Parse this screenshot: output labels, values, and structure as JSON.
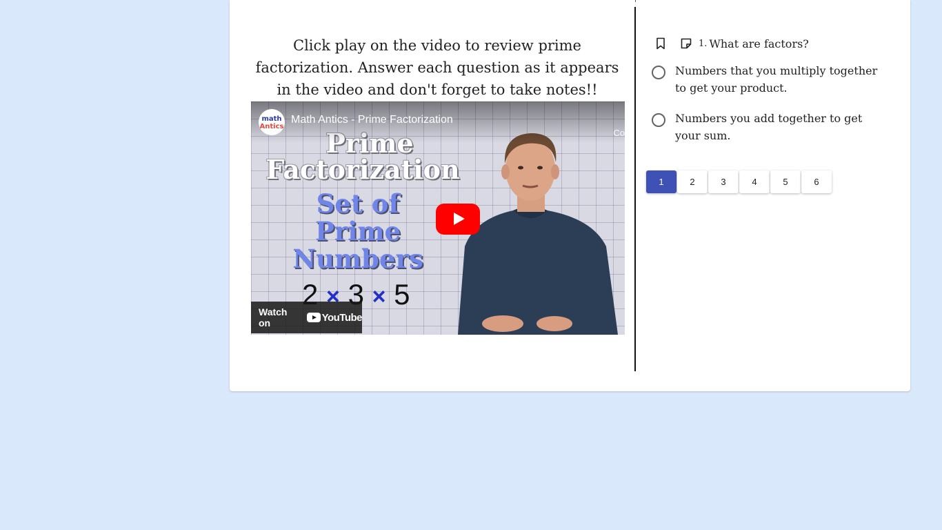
{
  "instructions": "Click play on the video to review prime factorization. Answer each question as it appears in the video and don't forget to take notes!!",
  "video": {
    "title": "Math Antics - Prime Factorization",
    "corner_text": "Co",
    "slide": {
      "title_line1": "Prime",
      "title_line2": "Factorization",
      "sub_line1": "Set of",
      "sub_line2": "Prime",
      "sub_line3": "Numbers",
      "eq_a": "2",
      "eq_x1": "×",
      "eq_b": "3",
      "eq_x2": "×",
      "eq_c": "5"
    },
    "watch_on_label": "Watch on",
    "youtube_label": "YouTube",
    "play_icon": "play-icon",
    "colors": {
      "play": "#ff0000"
    }
  },
  "question": {
    "number": "1.",
    "text": "What are factors?",
    "bookmark_icon": "bookmark-icon",
    "note_icon": "note-icon",
    "options": [
      {
        "label": "Numbers that you multiply together to get your product."
      },
      {
        "label": "Numbers you add together to get your sum."
      }
    ]
  },
  "pager": {
    "pages": [
      "1",
      "2",
      "3",
      "4",
      "5",
      "6"
    ],
    "active": "1",
    "colors": {
      "active": "#3f51b5"
    }
  }
}
